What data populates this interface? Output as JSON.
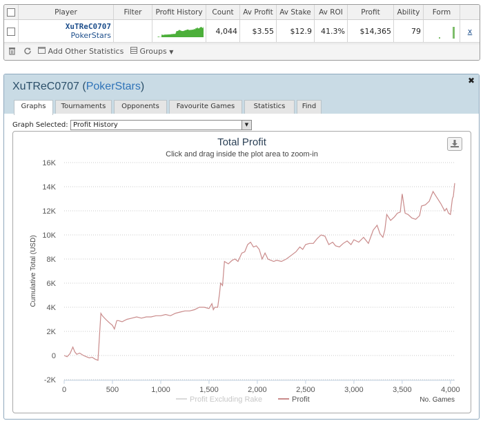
{
  "stats_table": {
    "headers": [
      "Player",
      "Filter",
      "Profit History",
      "Count",
      "Av Profit",
      "Av Stake",
      "Av ROI",
      "Profit",
      "Ability",
      "Form"
    ],
    "row": {
      "player_name": "XuTReC0707",
      "player_site": "PokerStars",
      "filter": "",
      "count": "4,044",
      "av_profit": "$3.55",
      "av_stake": "$12.9",
      "av_roi": "41.3%",
      "profit": "$14,365",
      "ability": "79",
      "remove": "x"
    },
    "toolbar": {
      "add_stats_label": "Add Other Statistics",
      "groups_label": "Groups"
    },
    "colors": {
      "sparkline": "#4caf3a",
      "form_bars": "#7dbd6a"
    }
  },
  "player_window": {
    "title_name": "XuTReC0707",
    "title_site": "PokerStars",
    "tabs": [
      "Graphs",
      "Tournaments",
      "Opponents",
      "Favourite Games",
      "Statistics",
      "Find"
    ],
    "active_tab": "Graphs",
    "graph_selected_label": "Graph Selected:",
    "graph_selected_value": "Profit History"
  },
  "chart_data": {
    "type": "line",
    "title": "Total Profit",
    "subtitle": "Click and drag inside the plot area to zoom-in",
    "xlabel": "No. Games",
    "ylabel": "Cumulative Total (USD)",
    "xlim": [
      0,
      4044
    ],
    "ylim": [
      -2000,
      16000
    ],
    "x_ticks": [
      0,
      500,
      1000,
      1500,
      2000,
      2500,
      3000,
      3500,
      4000
    ],
    "x_tick_labels": [
      "0",
      "500",
      "1,000",
      "1,500",
      "2,000",
      "2,500",
      "3,000",
      "3,500",
      "4,000"
    ],
    "y_ticks": [
      -2000,
      0,
      2000,
      4000,
      6000,
      8000,
      10000,
      12000,
      14000,
      16000
    ],
    "y_tick_labels": [
      "-2K",
      "0",
      "2K",
      "4K",
      "6K",
      "8K",
      "10K",
      "12K",
      "14K",
      "16K"
    ],
    "grid": true,
    "legend": "bottom",
    "series": [
      {
        "name": "Profit Excluding Rake",
        "color": "#d9d9d9",
        "values": []
      },
      {
        "name": "Profit",
        "color": "#c98a8a",
        "x": [
          0,
          30,
          60,
          90,
          110,
          130,
          160,
          200,
          230,
          260,
          290,
          320,
          350,
          380,
          395,
          430,
          470,
          500,
          520,
          545,
          560,
          600,
          650,
          700,
          750,
          800,
          850,
          900,
          950,
          1000,
          1050,
          1100,
          1150,
          1200,
          1250,
          1300,
          1350,
          1400,
          1450,
          1500,
          1530,
          1545,
          1560,
          1590,
          1610,
          1620,
          1640,
          1660,
          1700,
          1740,
          1770,
          1800,
          1840,
          1870,
          1900,
          1930,
          1960,
          1990,
          2020,
          2050,
          2080,
          2110,
          2140,
          2170,
          2200,
          2250,
          2300,
          2350,
          2400,
          2440,
          2470,
          2500,
          2540,
          2580,
          2620,
          2660,
          2700,
          2740,
          2780,
          2810,
          2850,
          2890,
          2930,
          2970,
          3000,
          3050,
          3100,
          3150,
          3200,
          3240,
          3270,
          3300,
          3320,
          3340,
          3380,
          3420,
          3450,
          3480,
          3500,
          3530,
          3560,
          3600,
          3640,
          3680,
          3700,
          3740,
          3780,
          3820,
          3860,
          3900,
          3940,
          3960,
          3980,
          4000,
          4020,
          4030,
          4044
        ],
        "values": [
          0,
          -100,
          150,
          700,
          300,
          100,
          200,
          0,
          -100,
          -200,
          -150,
          -300,
          -400,
          3500,
          3300,
          3000,
          2700,
          2500,
          2200,
          2900,
          2900,
          2800,
          3000,
          3100,
          3200,
          3100,
          3200,
          3200,
          3300,
          3300,
          3400,
          3300,
          3500,
          3600,
          3700,
          3700,
          3800,
          4000,
          4000,
          3900,
          4300,
          3800,
          4000,
          4000,
          5200,
          6000,
          5800,
          7800,
          7600,
          7900,
          8000,
          7800,
          8500,
          8600,
          9200,
          9400,
          9000,
          9100,
          8800,
          8000,
          8500,
          8000,
          7900,
          7800,
          7900,
          7800,
          8000,
          8300,
          8600,
          9000,
          8800,
          9200,
          9300,
          9300,
          9700,
          10000,
          9900,
          9200,
          9400,
          9100,
          9000,
          9300,
          9500,
          9200,
          9600,
          9400,
          9800,
          9300,
          10400,
          10800,
          10100,
          9800,
          10400,
          11700,
          11200,
          11500,
          11800,
          11900,
          13400,
          11800,
          11700,
          11400,
          11300,
          11600,
          12400,
          12500,
          12800,
          13600,
          13100,
          12600,
          12000,
          12200,
          11800,
          11700,
          13000,
          13200,
          14300
        ]
      }
    ]
  }
}
